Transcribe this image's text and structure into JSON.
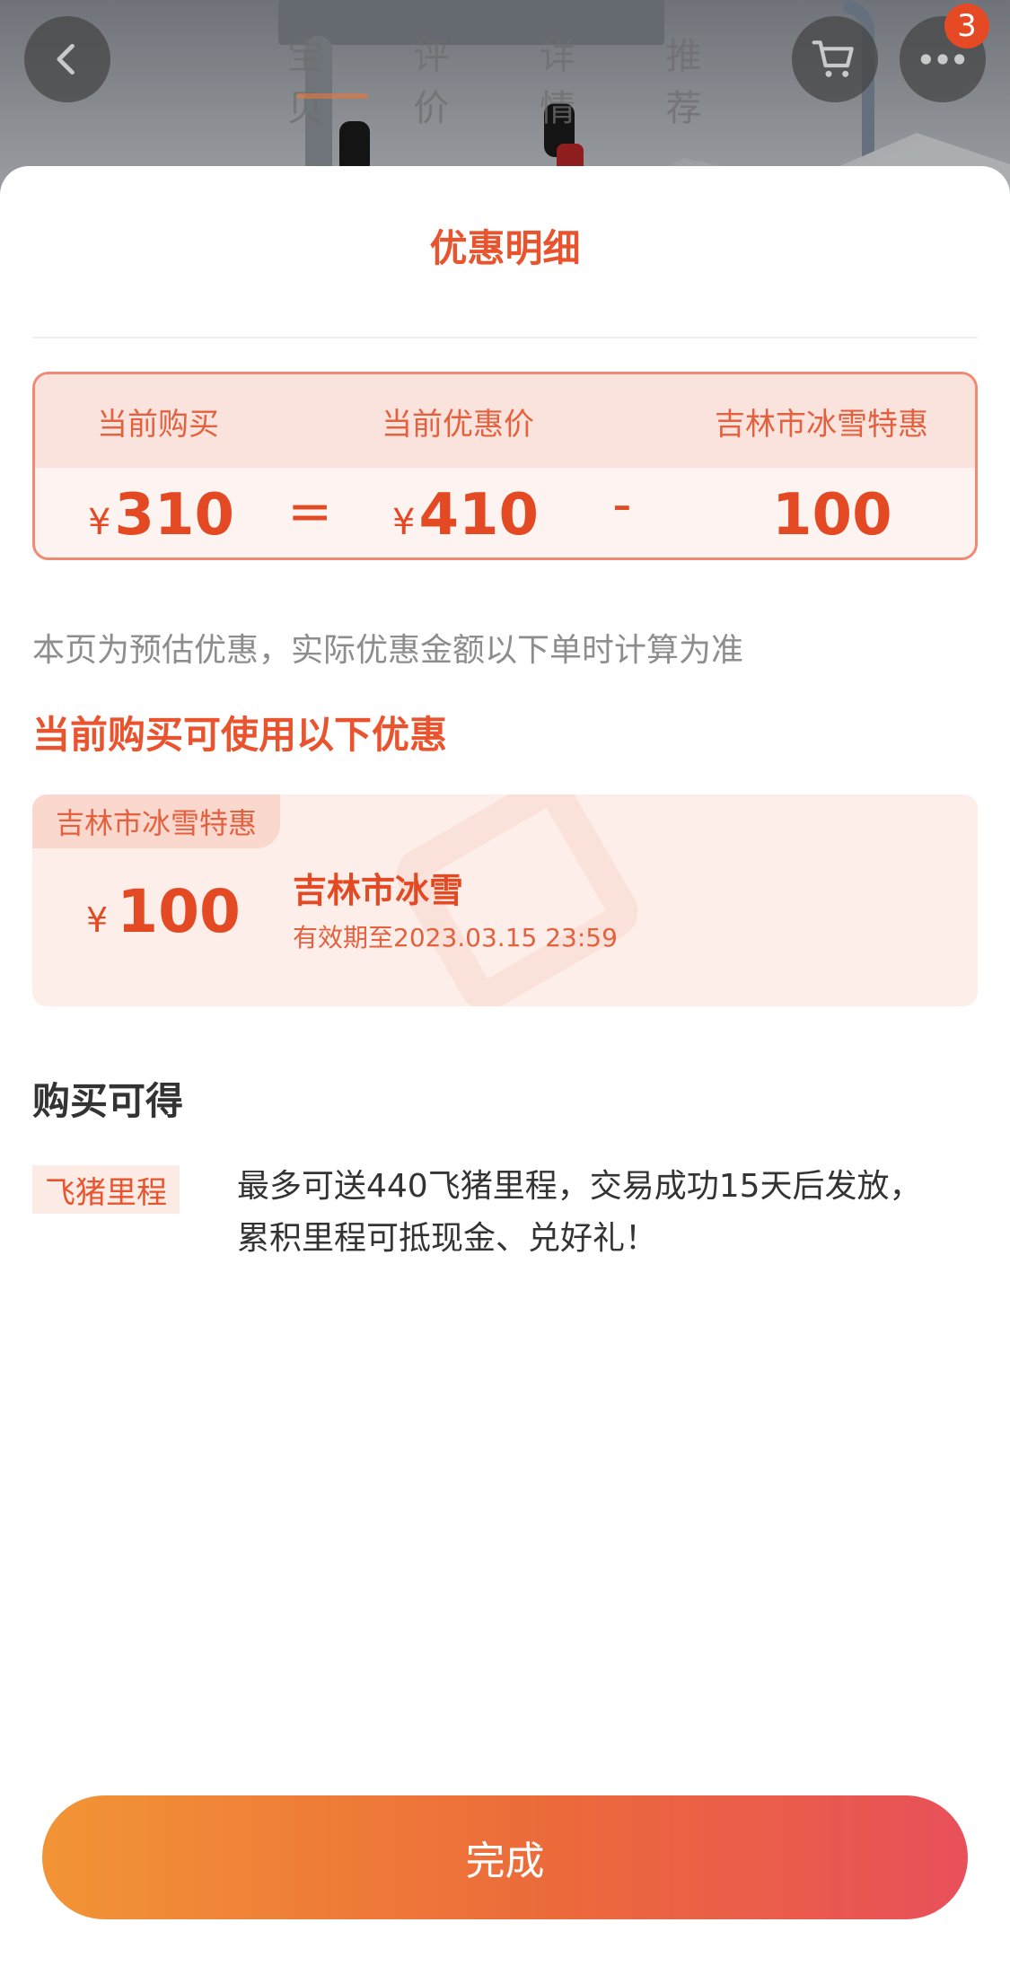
{
  "nav": {
    "tabs": [
      "宝贝",
      "评价",
      "详情",
      "推荐"
    ],
    "cart_badge": "3"
  },
  "sheet": {
    "title": "优惠明细",
    "equation": {
      "headers": [
        "当前购买",
        "当前优惠价",
        "吉林市冰雪特惠"
      ],
      "currency": "¥",
      "current_price": "310",
      "equals": "=",
      "original_price": "410",
      "minus": "-",
      "discount": "100"
    },
    "note": "本页为预估优惠，实际优惠金额以下单时计算为准",
    "available_section_title": "当前购买可使用以下优惠",
    "coupon": {
      "tag": "吉林市冰雪特惠",
      "currency": "¥",
      "amount": "100",
      "name": "吉林市冰雪",
      "expiry": "有效期至2023.03.15 23:59"
    },
    "earn_section_title": "购买可得",
    "miles": {
      "tag": "飞猪里程",
      "description_line1": "最多可送440飞猪里程，交易成功15天后发放，",
      "description_line2": "累积里程可抵现金、兑好礼！"
    },
    "done_label": "完成"
  },
  "colors": {
    "accent": "#e9542e",
    "price": "#e34a24",
    "button_start": "#f29436",
    "button_end": "#e8505a"
  }
}
